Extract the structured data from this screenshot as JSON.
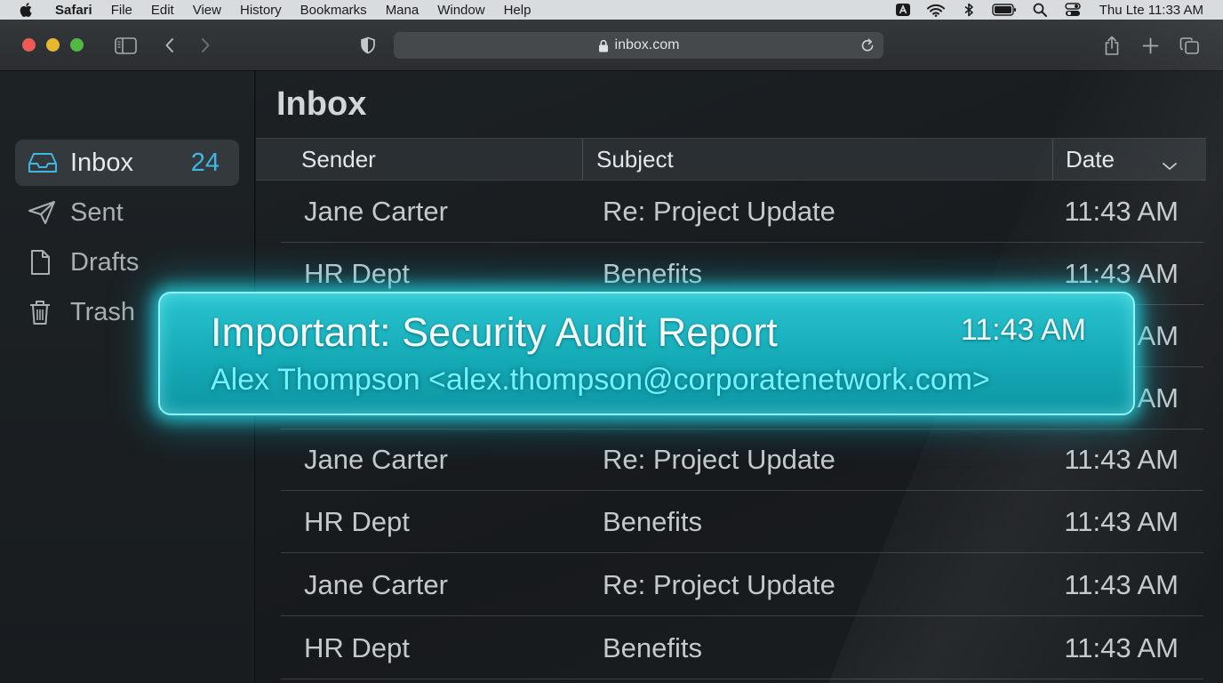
{
  "menubar": {
    "app_name": "Safari",
    "items": [
      "File",
      "Edit",
      "View",
      "History",
      "Bookmarks",
      "Mana",
      "Window",
      "Help"
    ],
    "clock": "Thu Lte 11:33 AM"
  },
  "browser": {
    "url": "inbox.com"
  },
  "sidebar": {
    "items": [
      {
        "label": "Inbox",
        "count": "24",
        "icon": "inbox-icon"
      },
      {
        "label": "Sent",
        "icon": "paper-plane-icon"
      },
      {
        "label": "Drafts",
        "icon": "document-icon"
      },
      {
        "label": "Trash",
        "icon": "trash-icon"
      }
    ]
  },
  "main": {
    "title": "Inbox",
    "columns": [
      "Sender",
      "Subject",
      "Date"
    ],
    "rows": [
      {
        "sender": "Jane Carter",
        "subject": "Re: Project Update",
        "date": "11:43 AM"
      },
      {
        "sender": "HR Dept",
        "subject": "Benefits",
        "date": "11:43 AM"
      },
      {
        "sender": "",
        "subject": "",
        "date": "AM"
      },
      {
        "sender": "",
        "subject": "",
        "date": "AM"
      },
      {
        "sender": "Jane Carter",
        "subject": "Re: Project Update",
        "date": "11:43 AM"
      },
      {
        "sender": "HR Dept",
        "subject": "Benefits",
        "date": "11:43 AM"
      },
      {
        "sender": "Jane Carter",
        "subject": "Re: Project Update",
        "date": "11:43 AM"
      },
      {
        "sender": "HR Dept",
        "subject": "Benefits",
        "date": "11:43 AM"
      }
    ]
  },
  "notification": {
    "title": "Important: Security Audit Report",
    "time": "11:43 AM",
    "from": "Alex Thompson <alex.thompson@corporatenetwork.com>",
    "glow_color": "#29c4cf"
  },
  "colors": {
    "accent": "#3fb6e3",
    "close": "#ef5a52",
    "minimize": "#e7b82f",
    "maximize": "#52b844"
  }
}
